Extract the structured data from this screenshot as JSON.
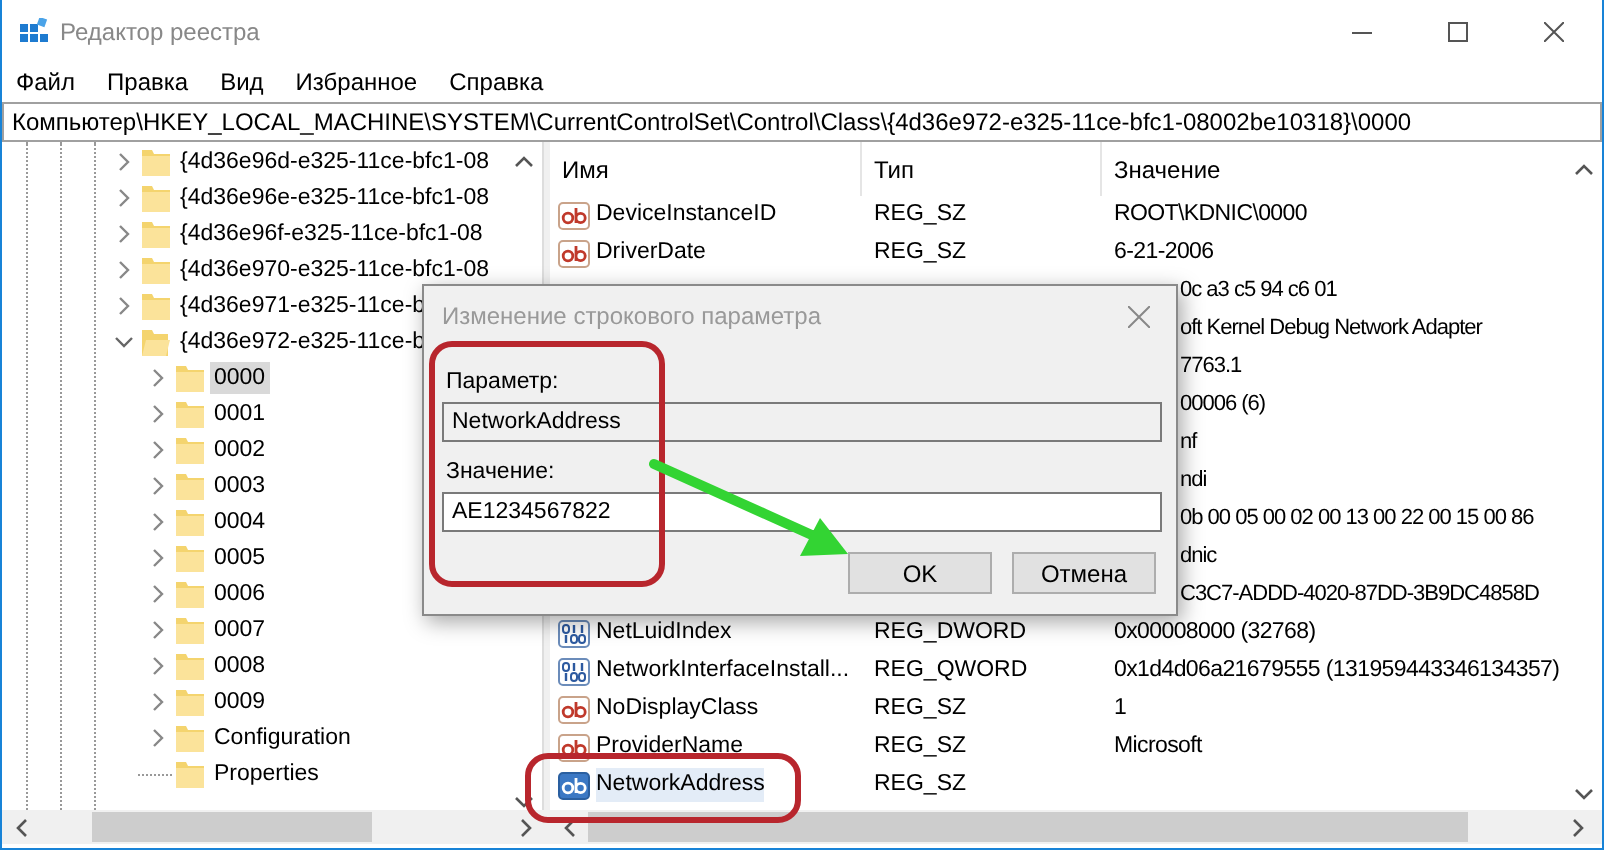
{
  "window": {
    "title": "Редактор реестра"
  },
  "menu": [
    "Файл",
    "Правка",
    "Вид",
    "Избранное",
    "Справка"
  ],
  "address": "Компьютер\\HKEY_LOCAL_MACHINE\\SYSTEM\\CurrentControlSet\\Control\\Class\\{4d36e972-e325-11ce-bfc1-08002be10318}\\0000",
  "tree": [
    {
      "label": "{4d36e96d-e325-11ce-bfc1-08",
      "has_children": true,
      "expanded": false,
      "selected": false
    },
    {
      "label": "{4d36e96e-e325-11ce-bfc1-08",
      "has_children": true,
      "expanded": false,
      "selected": false
    },
    {
      "label": "{4d36e96f-e325-11ce-bfc1-08",
      "has_children": true,
      "expanded": false,
      "selected": false
    },
    {
      "label": "{4d36e970-e325-11ce-bfc1-08",
      "has_children": true,
      "expanded": false,
      "selected": false
    },
    {
      "label": "{4d36e971-e325-11ce-b",
      "has_children": true,
      "expanded": false,
      "selected": false
    },
    {
      "label": "{4d36e972-e325-11ce-b",
      "has_children": true,
      "expanded": true,
      "selected": false,
      "children": [
        {
          "label": "0000",
          "has_children": true,
          "expanded": false,
          "selected": true
        },
        {
          "label": "0001",
          "has_children": true,
          "expanded": false,
          "selected": false
        },
        {
          "label": "0002",
          "has_children": true,
          "expanded": false,
          "selected": false
        },
        {
          "label": "0003",
          "has_children": true,
          "expanded": false,
          "selected": false
        },
        {
          "label": "0004",
          "has_children": true,
          "expanded": false,
          "selected": false
        },
        {
          "label": "0005",
          "has_children": true,
          "expanded": false,
          "selected": false
        },
        {
          "label": "0006",
          "has_children": true,
          "expanded": false,
          "selected": false
        },
        {
          "label": "0007",
          "has_children": true,
          "expanded": false,
          "selected": false
        },
        {
          "label": "0008",
          "has_children": true,
          "expanded": false,
          "selected": false
        },
        {
          "label": "0009",
          "has_children": true,
          "expanded": false,
          "selected": false
        },
        {
          "label": "Configuration",
          "has_children": true,
          "expanded": false,
          "selected": false
        },
        {
          "label": "Properties",
          "has_children": false,
          "expanded": false,
          "selected": false
        }
      ]
    }
  ],
  "list": {
    "columns": [
      "Имя",
      "Тип",
      "Значение"
    ],
    "rows": [
      {
        "kind": "string",
        "name": "DeviceInstanceID",
        "type": "REG_SZ",
        "value": "ROOT\\KDNIC\\0000",
        "selected": false
      },
      {
        "kind": "string",
        "name": "DriverDate",
        "type": "REG_SZ",
        "value": "6-21-2006",
        "selected": false
      },
      {
        "kind": "covered",
        "value": "0c a3 c5 94 c6 01"
      },
      {
        "kind": "covered",
        "value": "oft Kernel Debug Network Adapter"
      },
      {
        "kind": "covered",
        "value": "7763.1"
      },
      {
        "kind": "covered",
        "value": "00006 (6)"
      },
      {
        "kind": "covered",
        "value": "nf"
      },
      {
        "kind": "covered",
        "value": "ndi"
      },
      {
        "kind": "covered",
        "value": "0b 00 05 00 02 00 13 00 22 00 15 00 86"
      },
      {
        "kind": "covered",
        "value": "dnic"
      },
      {
        "kind": "covered",
        "value": "C3C7-ADDD-4020-87DD-3B9DC4858D"
      },
      {
        "kind": "binary",
        "name": "NetLuidIndex",
        "type": "REG_DWORD",
        "value": "0x00008000 (32768)",
        "selected": false
      },
      {
        "kind": "binary",
        "name": "NetworkInterfaceInstall...",
        "type": "REG_QWORD",
        "value": "0x1d4d06a21679555 (131959443346134357)",
        "selected": false
      },
      {
        "kind": "string",
        "name": "NoDisplayClass",
        "type": "REG_SZ",
        "value": "1",
        "selected": false
      },
      {
        "kind": "string",
        "name": "ProviderName",
        "type": "REG_SZ",
        "value": "Microsoft",
        "selected": false
      },
      {
        "kind": "string",
        "name": "NetworkAddress",
        "type": "REG_SZ",
        "selected": true
      }
    ]
  },
  "dialog": {
    "title": "Изменение строкового параметра",
    "fields": [
      {
        "label": "Параметр:",
        "value": "NetworkAddress",
        "disabled": true
      },
      {
        "label": "Значение:",
        "value": "AE1234567822",
        "disabled": false
      }
    ],
    "buttons": [
      "OK",
      "Отмена"
    ]
  },
  "annotations": [
    {
      "kind": "frame"
    },
    {
      "kind": "frame"
    },
    {
      "kind": "arrow"
    }
  ]
}
